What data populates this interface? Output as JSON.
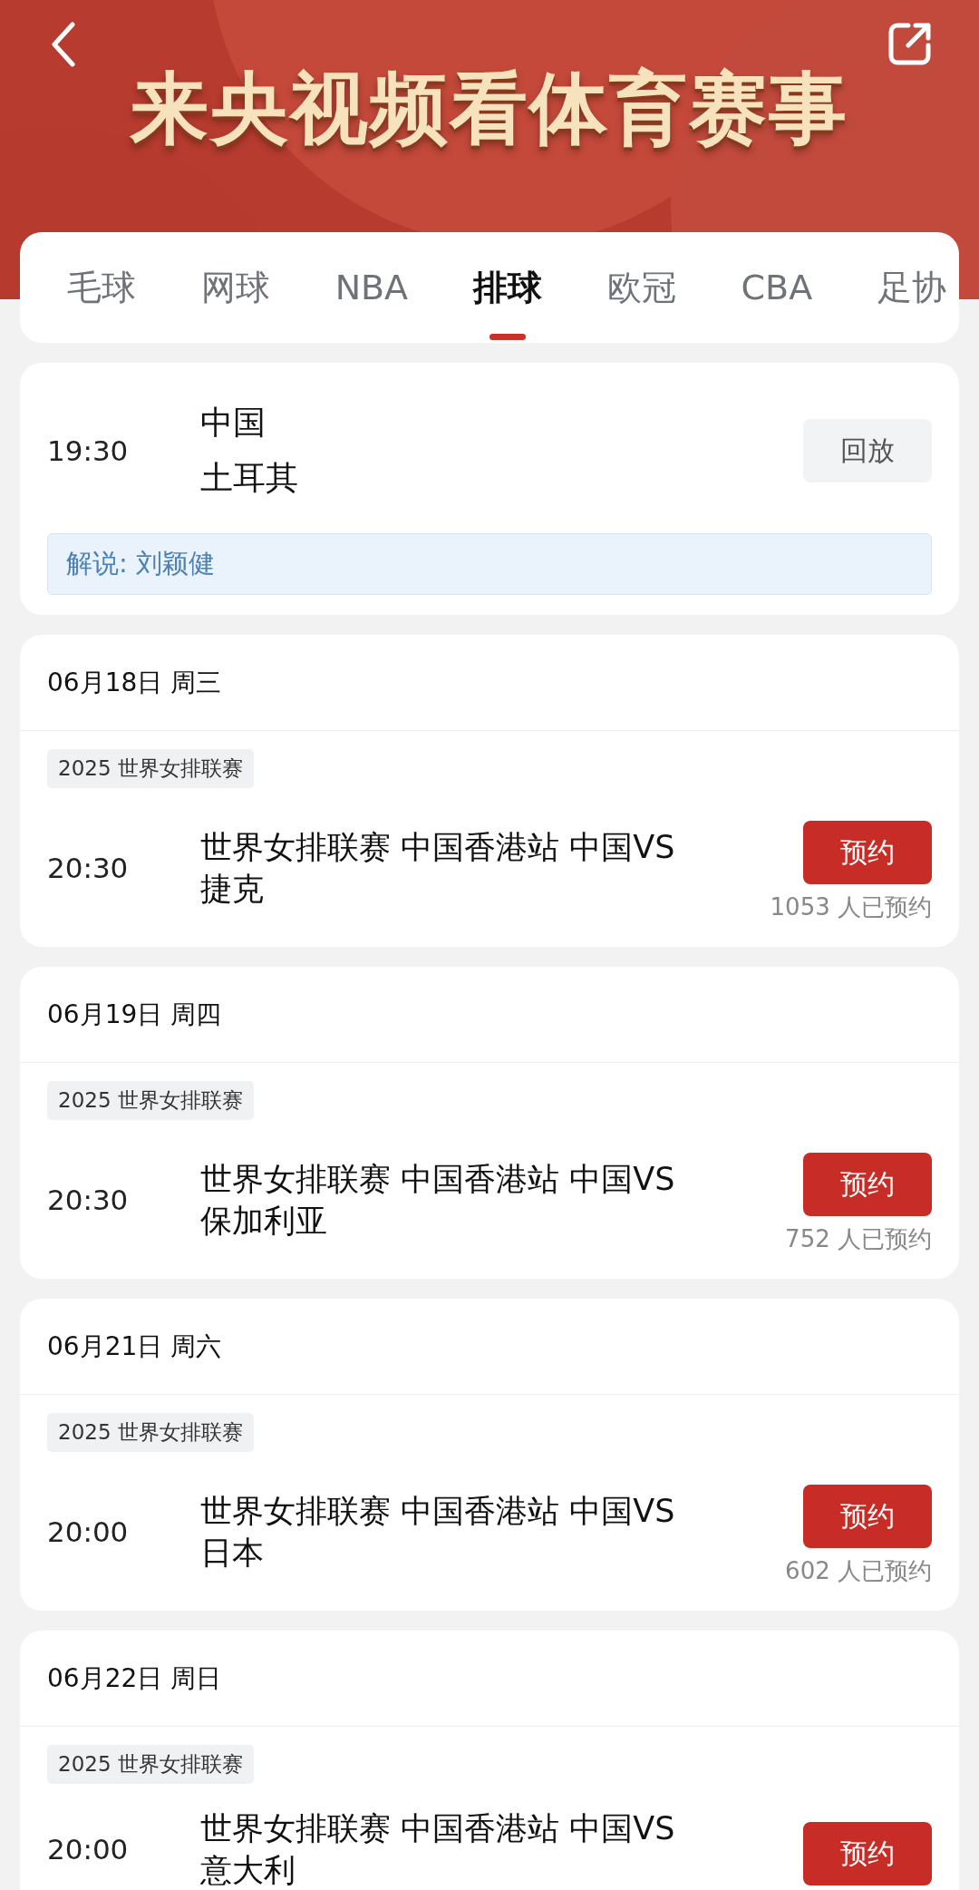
{
  "header": {
    "title": "来央视频看体育赛事"
  },
  "tabs": [
    {
      "label": "毛球",
      "selected": false
    },
    {
      "label": "网球",
      "selected": false
    },
    {
      "label": "NBA",
      "selected": false
    },
    {
      "label": "排球",
      "selected": true
    },
    {
      "label": "欧冠",
      "selected": false
    },
    {
      "label": "CBA",
      "selected": false
    },
    {
      "label": "足协",
      "selected": false
    }
  ],
  "matches": [
    {
      "kind": "replay",
      "time": "19:30",
      "teams": [
        "中国",
        "土耳其"
      ],
      "button": "回放",
      "commentary": "解说: 刘颖健"
    },
    {
      "kind": "upcoming",
      "date": "06月18日 周三",
      "tag": "2025 世界女排联赛",
      "time": "20:30",
      "title": "世界女排联赛 中国香港站 中国VS 捷克",
      "button": "预约",
      "count": "1053 人已预约"
    },
    {
      "kind": "upcoming",
      "date": "06月19日 周四",
      "tag": "2025 世界女排联赛",
      "time": "20:30",
      "title": "世界女排联赛 中国香港站 中国VS 保加利亚",
      "button": "预约",
      "count": "752 人已预约"
    },
    {
      "kind": "upcoming",
      "date": "06月21日 周六",
      "tag": "2025 世界女排联赛",
      "time": "20:00",
      "title": "世界女排联赛 中国香港站 中国VS 日本",
      "button": "预约",
      "count": "602 人已预约"
    },
    {
      "kind": "upcoming",
      "date": "06月22日 周日",
      "tag": "2025 世界女排联赛",
      "time": "20:00",
      "title": "世界女排联赛 中国香港站 中国VS 意大利",
      "button": "预约"
    }
  ]
}
